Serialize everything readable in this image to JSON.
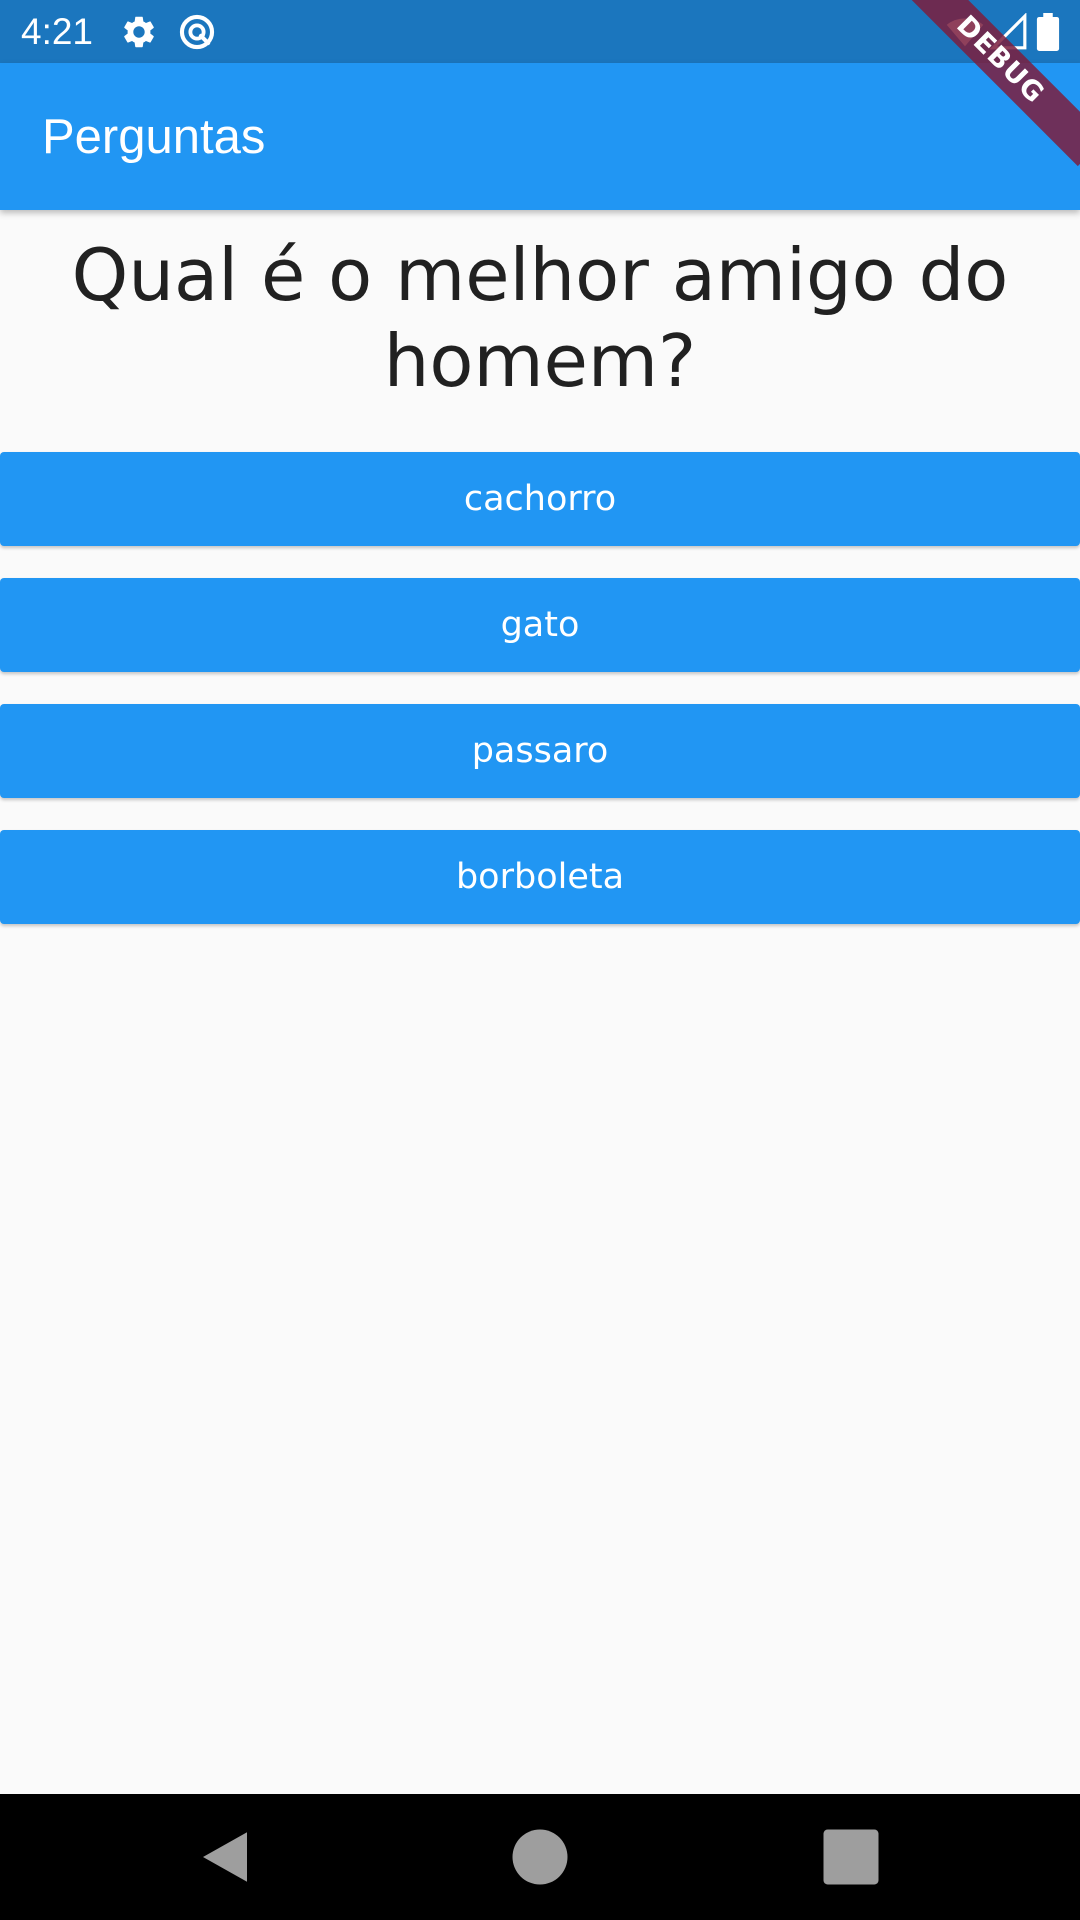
{
  "status_bar": {
    "time": "4:21",
    "icons": [
      "settings-gear-icon",
      "sync-circle-icon",
      "wifi-icon",
      "cell-signal-icon",
      "battery-icon"
    ]
  },
  "debug_banner": {
    "label": "DEBUG"
  },
  "app_bar": {
    "title": "Perguntas"
  },
  "question": {
    "text": "Qual é o melhor amigo do homem?"
  },
  "answers": [
    {
      "label": "cachorro"
    },
    {
      "label": "gato"
    },
    {
      "label": "passaro"
    },
    {
      "label": "borboleta"
    }
  ],
  "navigation": {
    "buttons": [
      "back-triangle-icon",
      "home-circle-icon",
      "recents-square-icon"
    ]
  },
  "colors": {
    "primary": "#2196f3",
    "status_bar": "#1b76be",
    "background": "#fafafa",
    "text_dark": "#212121",
    "debug": "#7b1f3e"
  }
}
